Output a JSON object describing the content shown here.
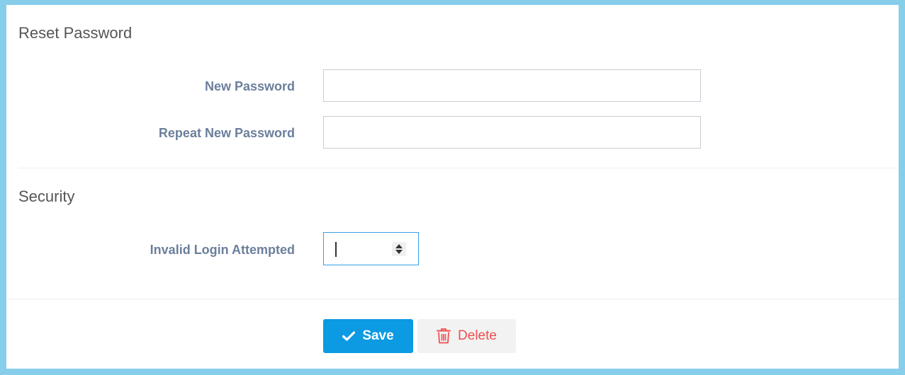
{
  "reset_password": {
    "title": "Reset Password",
    "new_password_label": "New Password",
    "new_password_value": "",
    "repeat_password_label": "Repeat New Password",
    "repeat_password_value": ""
  },
  "security": {
    "title": "Security",
    "invalid_login_label": "Invalid Login Attempted",
    "invalid_login_value": ""
  },
  "actions": {
    "save_label": "Save",
    "save_icon": "check-icon",
    "delete_label": "Delete",
    "delete_icon": "trash-icon"
  },
  "colors": {
    "frame": "#87ceeb",
    "primary": "#0c9ae3",
    "danger": "#ef4f4f",
    "label": "#6b7f9c"
  }
}
